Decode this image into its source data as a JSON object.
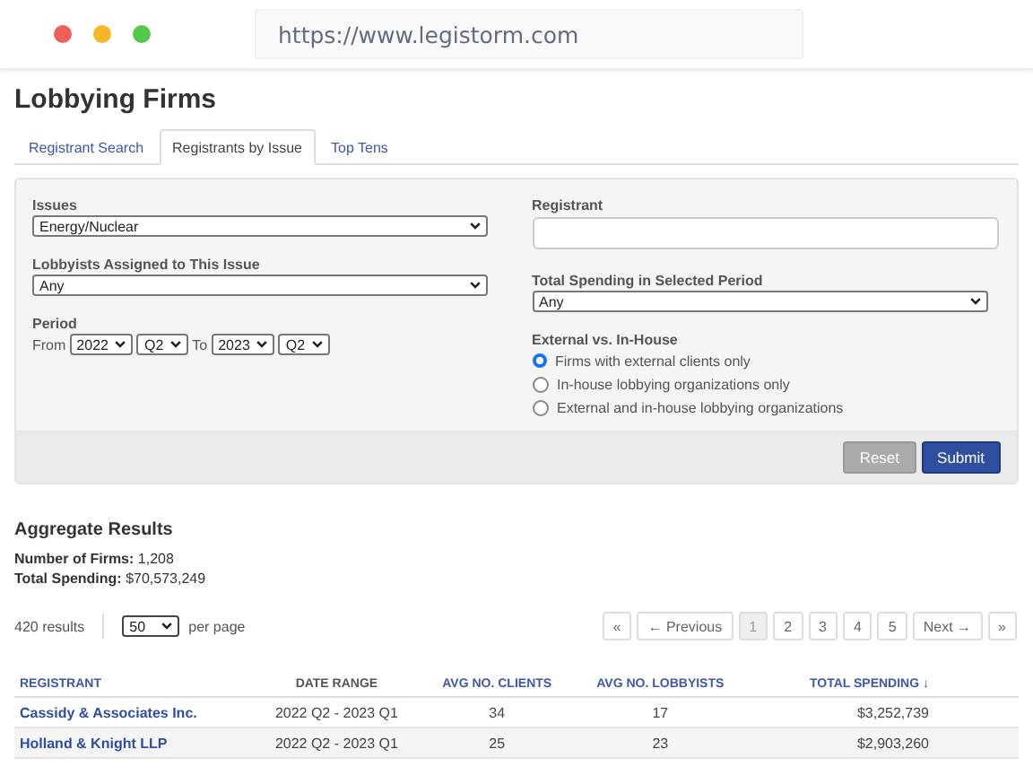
{
  "browser": {
    "url": "https://www.legistorm.com"
  },
  "page": {
    "title": "Lobbying Firms"
  },
  "tabs": [
    {
      "label": "Registrant Search",
      "selected": false
    },
    {
      "label": "Registrants by Issue",
      "selected": true
    },
    {
      "label": "Top Tens",
      "selected": false
    }
  ],
  "filters": {
    "issues": {
      "label": "Issues",
      "value": "Energy/Nuclear"
    },
    "lobbyists": {
      "label": "Lobbyists Assigned to This Issue",
      "value": "Any"
    },
    "period": {
      "label": "Period",
      "from_label": "From",
      "from_year": "2022",
      "from_quarter": "Q2",
      "to_label": "To",
      "to_year": "2023",
      "to_quarter": "Q2"
    },
    "registrant": {
      "label": "Registrant"
    },
    "spending": {
      "label": "Total Spending in Selected Period",
      "value": "Any"
    },
    "external": {
      "label": "External vs. In-House",
      "options": [
        {
          "label": "Firms with external clients only",
          "selected": true
        },
        {
          "label": "In-house lobbying organizations only",
          "selected": false
        },
        {
          "label": "External and in-house lobbying organizations",
          "selected": false
        }
      ]
    },
    "buttons": [
      {
        "label": "Reset",
        "kind": "secondary"
      },
      {
        "label": "Submit",
        "kind": "primary"
      }
    ]
  },
  "aggregate": {
    "title": "Aggregate Results",
    "stats": [
      {
        "label": "Number of Firms:",
        "value": "1,208"
      },
      {
        "label": "Total Spending:",
        "value": "$70,573,249"
      }
    ]
  },
  "results_bar": {
    "count": "420 results",
    "per_page": "50",
    "per_page_label": "per page"
  },
  "pagination": [
    {
      "label": "«",
      "selected": false
    },
    {
      "label": "← Previous",
      "selected": false
    },
    {
      "label": "1",
      "selected": true
    },
    {
      "label": "2",
      "selected": false
    },
    {
      "label": "3",
      "selected": false
    },
    {
      "label": "4",
      "selected": false
    },
    {
      "label": "5",
      "selected": false
    },
    {
      "label": "Next →",
      "selected": false
    },
    {
      "label": "»",
      "selected": false
    }
  ],
  "table": {
    "columns": [
      {
        "label": "REGISTRANT",
        "kind": "link"
      },
      {
        "label": "DATE RANGE",
        "kind": "plain"
      },
      {
        "label": "AVG NO. CLIENTS",
        "kind": "link"
      },
      {
        "label": "AVG NO. LOBBYISTS",
        "kind": "link"
      },
      {
        "label": "TOTAL SPENDING ↓",
        "kind": "link"
      }
    ],
    "rows": [
      [
        "Cassidy & Associates Inc.",
        "2022 Q2 - 2023 Q1",
        "34",
        "17",
        "$3,252,739"
      ],
      [
        "Holland & Knight LLP",
        "2022 Q2 - 2023 Q1",
        "25",
        "23",
        "$2,903,260"
      ]
    ]
  }
}
